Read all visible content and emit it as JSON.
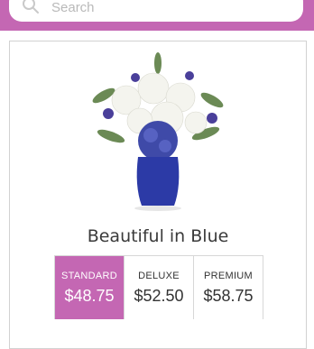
{
  "search": {
    "placeholder": "Search"
  },
  "product": {
    "title": "Beautiful in Blue"
  },
  "options": [
    {
      "label": "STANDARD",
      "price": "$48.75",
      "selected": true
    },
    {
      "label": "DELUXE",
      "price": "$52.50",
      "selected": false
    },
    {
      "label": "PREMIUM",
      "price": "$58.75",
      "selected": false
    }
  ],
  "colors": {
    "accent": "#c467b3",
    "vase": "#2c3aa6",
    "hydrangea": "#3f4aa8"
  },
  "icons": {
    "search": "search-icon"
  }
}
